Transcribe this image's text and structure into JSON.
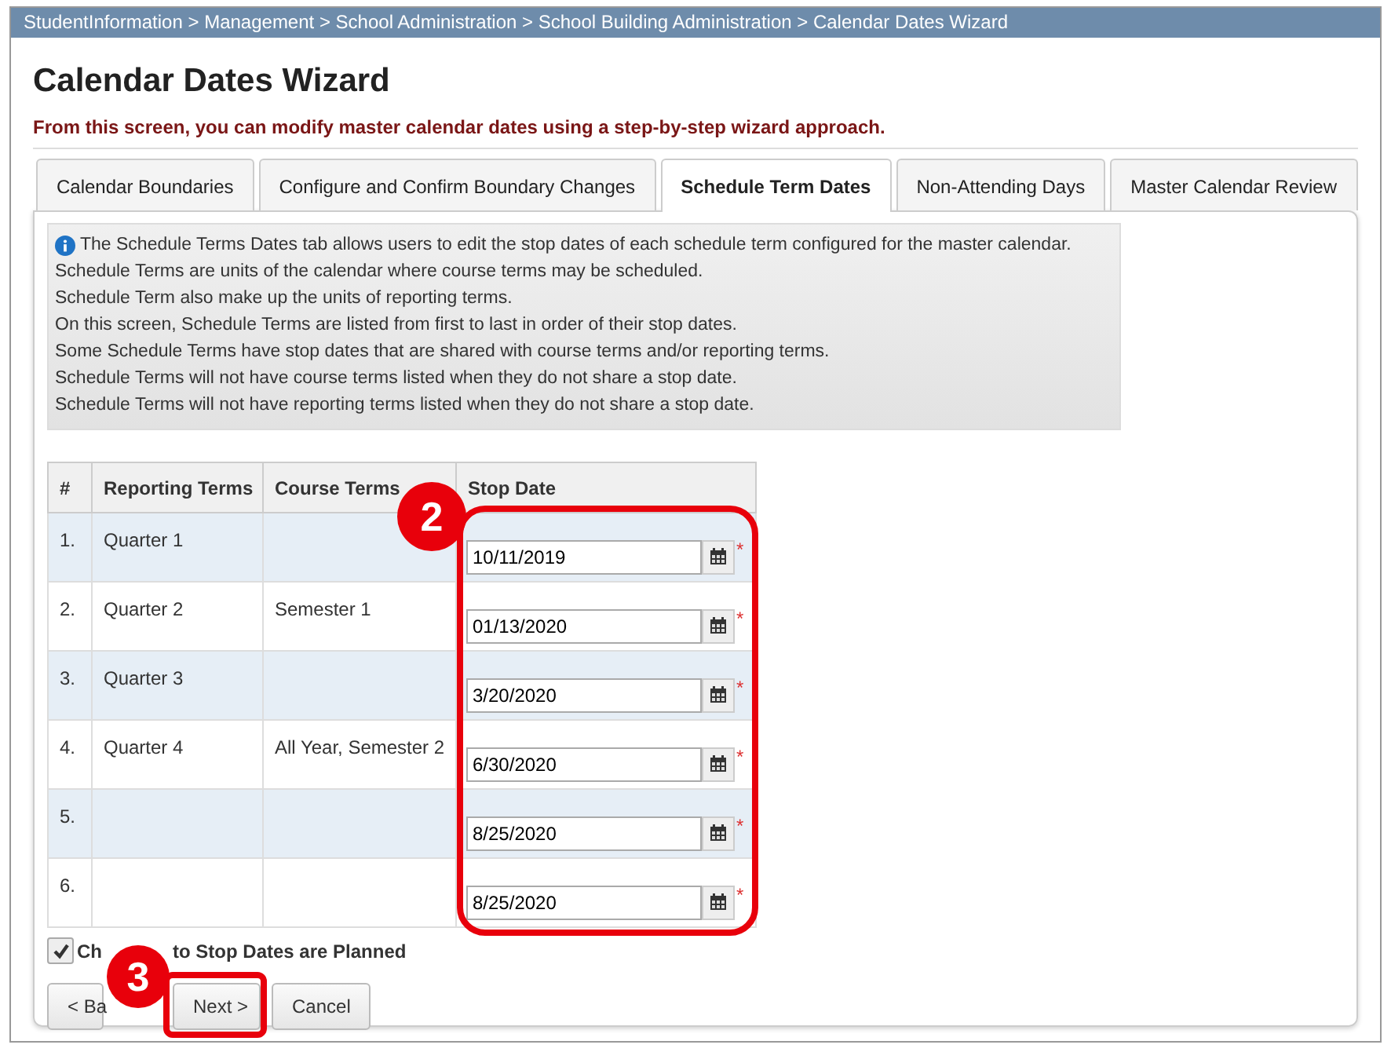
{
  "breadcrumb": "StudentInformation > Management > School Administration > School Building Administration > Calendar Dates Wizard",
  "title": "Calendar Dates Wizard",
  "subtitle": "From this screen, you can modify master calendar dates using a step-by-step wizard approach.",
  "tabs": [
    {
      "label": "Calendar Boundaries",
      "selected": false
    },
    {
      "label": "Configure and Confirm Boundary Changes",
      "selected": false
    },
    {
      "label": "Schedule Term Dates",
      "selected": true
    },
    {
      "label": "Non-Attending Days",
      "selected": false
    },
    {
      "label": "Master Calendar Review",
      "selected": false
    }
  ],
  "info": [
    "The Schedule Terms Dates tab allows users to edit the stop dates of each schedule term configured for the master calendar.",
    "Schedule Terms are units of the calendar where course terms may be scheduled.",
    "Schedule Term also make up the units of reporting terms.",
    "On this screen, Schedule Terms are listed from first to last in order of their stop dates.",
    "Some Schedule Terms have stop dates that are shared with course terms and/or reporting terms.",
    "Schedule Terms will not have course terms listed when they do not share a stop date.",
    "Schedule Terms will not have reporting terms listed when they do not share a stop date."
  ],
  "table": {
    "columns": [
      "#",
      "Reporting Terms",
      "Course Terms",
      "Stop Date"
    ],
    "rows": [
      {
        "num": "1.",
        "reporting": "Quarter 1",
        "course": "",
        "date": "10/11/2019",
        "required": "*"
      },
      {
        "num": "2.",
        "reporting": "Quarter 2",
        "course": "Semester 1",
        "date": "01/13/2020",
        "required": "*"
      },
      {
        "num": "3.",
        "reporting": "Quarter 3",
        "course": "",
        "date": "3/20/2020",
        "required": "*"
      },
      {
        "num": "4.",
        "reporting": "Quarter 4",
        "course": "All Year, Semester 2",
        "date": "6/30/2020",
        "required": "*"
      },
      {
        "num": "5.",
        "reporting": "",
        "course": "",
        "date": "8/25/2020",
        "required": "*"
      },
      {
        "num": "6.",
        "reporting": "",
        "course": "",
        "date": "8/25/2020",
        "required": "*"
      }
    ]
  },
  "checkbox": {
    "checked": true,
    "label_start": "Ch",
    "label_end": "to Stop Dates are Planned"
  },
  "buttons": [
    "< Ba",
    "Next >",
    "Cancel"
  ],
  "callouts": [
    {
      "number": "2"
    },
    {
      "number": "3"
    }
  ]
}
